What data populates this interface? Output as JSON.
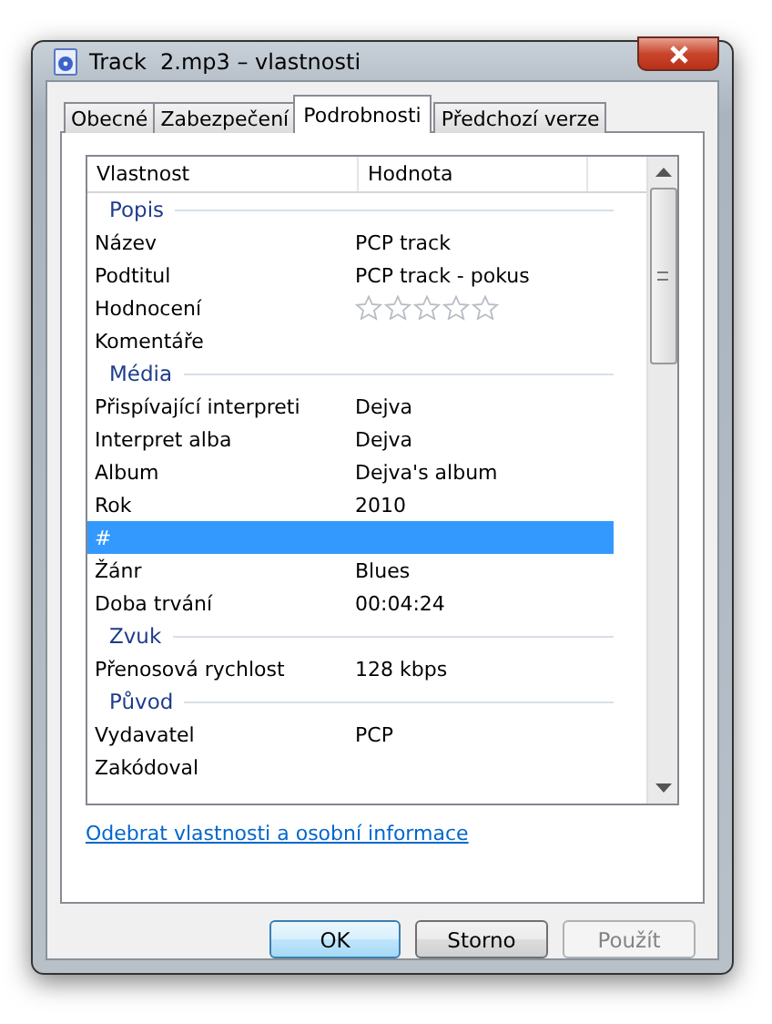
{
  "window": {
    "title": "Track  2.mp3 – vlastnosti"
  },
  "tabs": [
    {
      "label": "Obecné",
      "selected": false
    },
    {
      "label": "Zabezpečení",
      "selected": false
    },
    {
      "label": "Podrobnosti",
      "selected": true
    },
    {
      "label": "Předchozí verze",
      "selected": false
    }
  ],
  "table": {
    "columns": [
      "Vlastnost",
      "Hodnota"
    ],
    "rows": [
      {
        "kind": "group",
        "label": "Popis"
      },
      {
        "kind": "property",
        "name": "Název",
        "value": "PCP track",
        "selected": false
      },
      {
        "kind": "property",
        "name": "Podtitul",
        "value": "PCP track - pokus",
        "selected": false
      },
      {
        "kind": "rating",
        "name": "Hodnocení",
        "stars": 0,
        "selected": false
      },
      {
        "kind": "property",
        "name": "Komentáře",
        "selected": false
      },
      {
        "kind": "group",
        "label": "Média"
      },
      {
        "kind": "property",
        "name": "Přispívající interpreti",
        "value": "Dejva",
        "selected": false
      },
      {
        "kind": "property",
        "name": "Interpret alba",
        "value": "Dejva",
        "selected": false
      },
      {
        "kind": "property",
        "name": "Album",
        "value": "Dejva's album",
        "selected": false
      },
      {
        "kind": "property",
        "name": "Rok",
        "value": "2010",
        "selected": false
      },
      {
        "kind": "property",
        "name": "#",
        "selected": true
      },
      {
        "kind": "property",
        "name": "Žánr",
        "value": "Blues",
        "selected": false
      },
      {
        "kind": "property",
        "name": "Doba trvání",
        "value": "00:04:24",
        "selected": false
      },
      {
        "kind": "group",
        "label": "Zvuk"
      },
      {
        "kind": "property",
        "name": "Přenosová rychlost",
        "value": "128 kbps",
        "selected": false
      },
      {
        "kind": "group",
        "label": "Původ"
      },
      {
        "kind": "property",
        "name": "Vydavatel",
        "value": "PCP",
        "selected": false
      },
      {
        "kind": "property",
        "name": "Zakódoval",
        "selected": false
      }
    ]
  },
  "link": "Odebrat vlastnosti a osobní informace",
  "buttons": [
    {
      "label": "OK",
      "disabled": false
    },
    {
      "label": "Storno",
      "disabled": false
    },
    {
      "label": "Použít",
      "disabled": true
    }
  ]
}
